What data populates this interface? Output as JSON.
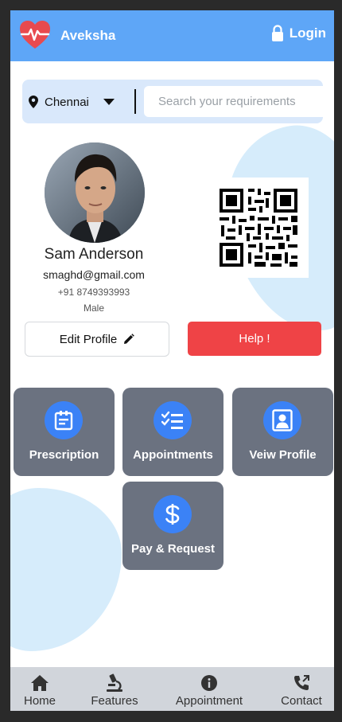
{
  "header": {
    "app_name": "Aveksha",
    "login_label": "Login"
  },
  "search": {
    "city": "Chennai",
    "placeholder": "Search your requirements",
    "value": ""
  },
  "profile": {
    "name": "Sam Anderson",
    "email": "smaghd@gmail.com",
    "phone": "+91 8749393993",
    "gender": "Male",
    "edit_label": "Edit Profile",
    "help_label": "Help !"
  },
  "tiles": [
    {
      "label": "Prescription",
      "icon": "prescription-icon"
    },
    {
      "label": "Appointments",
      "icon": "checklist-icon"
    },
    {
      "label": "Veiw Profile",
      "icon": "profile-card-icon"
    },
    {
      "label": "Pay & Request",
      "icon": "dollar-icon"
    }
  ],
  "bottom_nav": [
    {
      "label": "Home",
      "icon": "home-icon"
    },
    {
      "label": "Features",
      "icon": "microscope-icon"
    },
    {
      "label": "Appointment",
      "icon": "info-icon"
    },
    {
      "label": "Contact",
      "icon": "phone-icon"
    }
  ],
  "colors": {
    "header": "#5ea6f7",
    "accent_blue": "#3b82f6",
    "tile_bg": "#6b7280",
    "help_red": "#ef4346",
    "logo_red": "#e84a4f",
    "blob": "#d6ecfb",
    "nav_bg": "#d1d5db"
  }
}
